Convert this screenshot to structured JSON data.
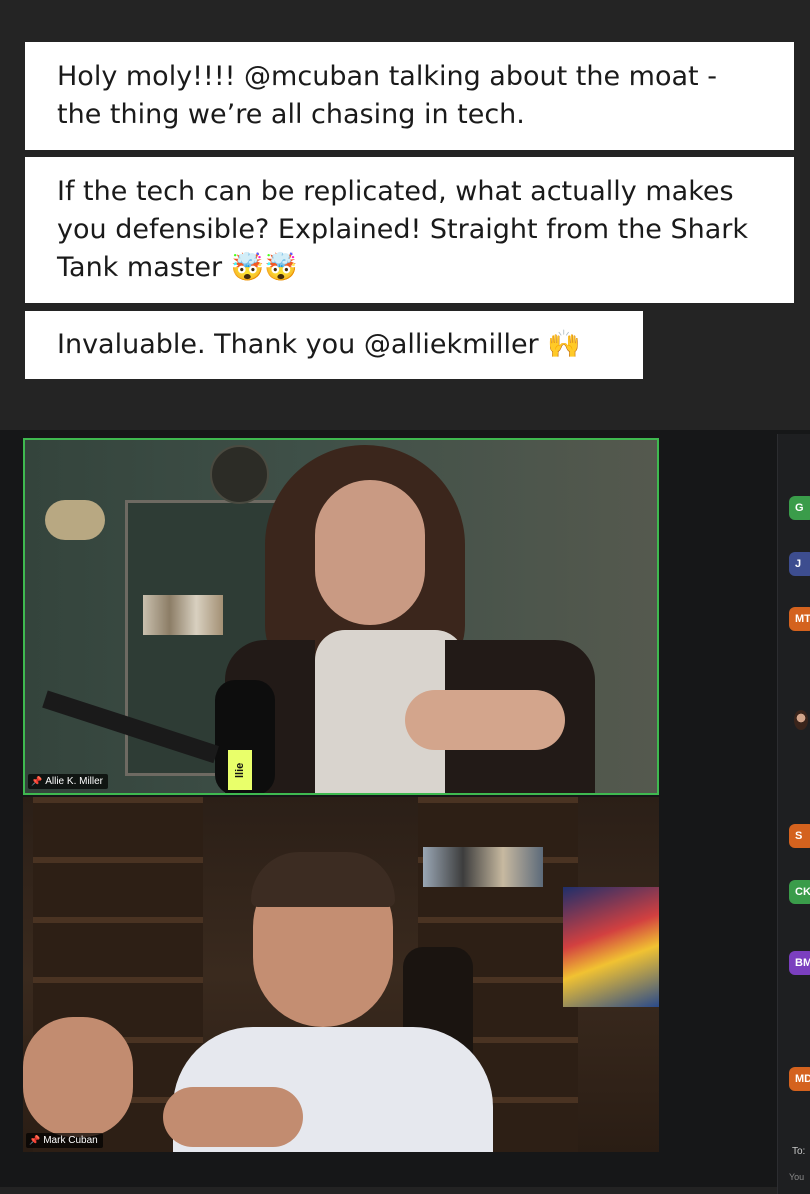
{
  "captions": [
    "Holy moly!!!! @mcuban talking about the moat - the thing we’re all chasing in tech.",
    "If the tech can be replicated, what actually makes you defensible? Explained! Straight from the Shark Tank master 🤯🤯",
    "Invaluable. Thank you @alliekmiller 🙌"
  ],
  "participants": [
    {
      "name": "Allie K. Miller"
    },
    {
      "name": "Mark Cuban"
    }
  ],
  "mic_label": "llie",
  "side_avatars": [
    {
      "initials": "G",
      "color": "#3a9c4a"
    },
    {
      "initials": "J",
      "color": "#3d4d8f"
    },
    {
      "initials": "MT",
      "color": "#d4621e"
    },
    {
      "initials": "S",
      "color": "#d4621e"
    },
    {
      "initials": "CK",
      "color": "#3a9c4a"
    },
    {
      "initials": "BM",
      "color": "#7b3fbf"
    },
    {
      "initials": "MD",
      "color": "#d4621e"
    }
  ],
  "chat": {
    "to_label": "To:",
    "you_label": "You"
  },
  "colors": {
    "active_speaker_border": "#3fb950"
  }
}
